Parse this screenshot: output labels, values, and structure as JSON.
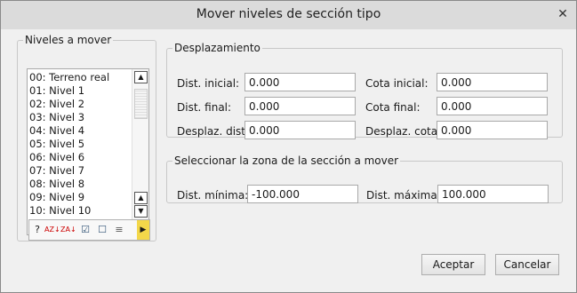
{
  "window": {
    "title": "Mover niveles de sección tipo",
    "close": "✕"
  },
  "levels": {
    "legend": "Niveles a mover",
    "items": [
      "00: Terreno real",
      "01: Nivel 1",
      "02: Nivel 2",
      "03: Nivel 3",
      "04: Nivel 4",
      "05: Nivel 5",
      "06: Nivel 6",
      "07: Nivel 7",
      "08: Nivel 8",
      "09: Nivel 9",
      "10: Nivel 10"
    ],
    "toolbar": {
      "help_icon": "?",
      "sort_az_icon": "AZ↓",
      "sort_za_icon": "ZA↓",
      "check_all_icon": "☑",
      "uncheck_icon": "☐",
      "list_icon": "≡",
      "more_icon": "▶"
    }
  },
  "displacement": {
    "legend": "Desplazamiento",
    "dist_inicial_label": "Dist. inicial:",
    "dist_inicial_value": "0.000",
    "cota_inicial_label": "Cota inicial:",
    "cota_inicial_value": "0.000",
    "dist_final_label": "Dist. final:",
    "dist_final_value": "0.000",
    "cota_final_label": "Cota final:",
    "cota_final_value": "0.000",
    "desplaz_dist_label": "Desplaz. dist.:",
    "desplaz_dist_value": "0.000",
    "desplaz_cota_label": "Desplaz. cota:",
    "desplaz_cota_value": "0.000"
  },
  "zone": {
    "legend": "Seleccionar la zona de la sección a mover",
    "dist_min_label": "Dist. mínima:",
    "dist_min_value": "-100.000",
    "dist_max_label": "Dist. máxima:",
    "dist_max_value": "100.000"
  },
  "buttons": {
    "accept": "Aceptar",
    "cancel": "Cancelar"
  }
}
